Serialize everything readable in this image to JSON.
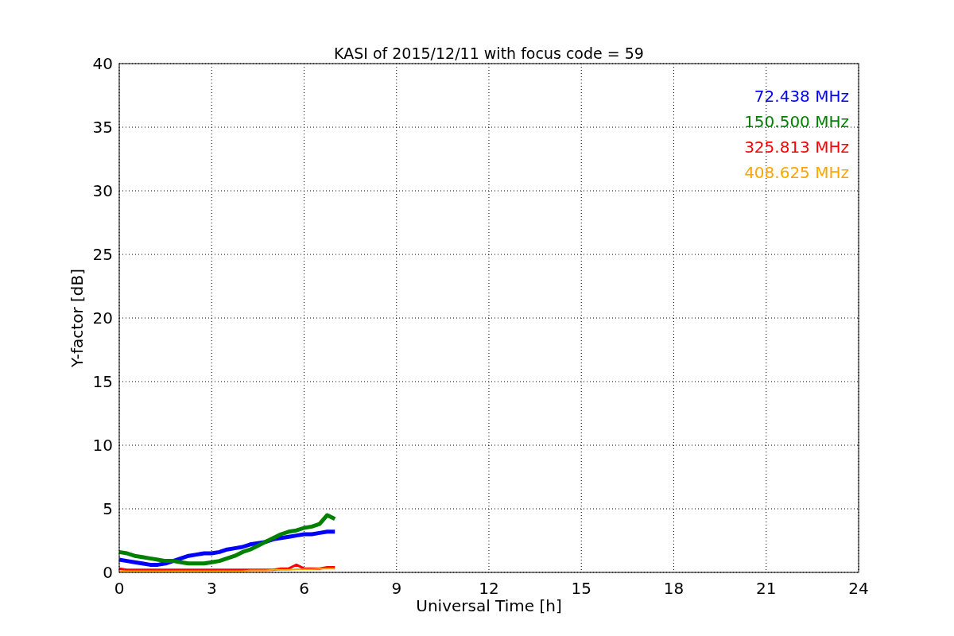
{
  "chart_data": {
    "type": "line",
    "title": "KASI of 2015/12/11 with focus code = 59",
    "xlabel": "Universal Time [h]",
    "ylabel": "Y-factor [dB]",
    "x": [
      0,
      0.25,
      0.5,
      0.75,
      1,
      1.25,
      1.5,
      1.75,
      2,
      2.25,
      2.5,
      2.75,
      3,
      3.25,
      3.5,
      3.75,
      4,
      4.25,
      4.5,
      4.75,
      5,
      5.25,
      5.5,
      5.75,
      6,
      6.25,
      6.5,
      6.75,
      7
    ],
    "grid": true,
    "xlim": [
      0,
      24
    ],
    "ylim": [
      0,
      40
    ],
    "xticks": [
      0,
      3,
      6,
      9,
      12,
      15,
      18,
      21,
      24
    ],
    "yticks": [
      0,
      5,
      10,
      15,
      20,
      25,
      30,
      35,
      40
    ],
    "series": [
      {
        "name": "72.438 MHz",
        "color": "#0000ff",
        "values": [
          1.0,
          0.9,
          0.8,
          0.7,
          0.6,
          0.6,
          0.7,
          0.9,
          1.1,
          1.3,
          1.4,
          1.5,
          1.5,
          1.6,
          1.8,
          1.9,
          2.0,
          2.2,
          2.3,
          2.4,
          2.6,
          2.7,
          2.8,
          2.9,
          3.0,
          3.0,
          3.1,
          3.2,
          3.2
        ]
      },
      {
        "name": "150.500 MHz",
        "color": "#008000",
        "values": [
          1.6,
          1.5,
          1.3,
          1.2,
          1.1,
          1.0,
          0.9,
          0.9,
          0.8,
          0.7,
          0.7,
          0.7,
          0.8,
          0.9,
          1.1,
          1.3,
          1.6,
          1.8,
          2.1,
          2.4,
          2.7,
          3.0,
          3.2,
          3.3,
          3.5,
          3.6,
          3.8,
          4.5,
          4.2
        ]
      },
      {
        "name": "325.813 MHz",
        "color": "#ff0000",
        "values": [
          0.3,
          0.2,
          0.2,
          0.2,
          0.2,
          0.2,
          0.2,
          0.2,
          0.2,
          0.2,
          0.2,
          0.2,
          0.2,
          0.2,
          0.2,
          0.2,
          0.2,
          0.2,
          0.2,
          0.2,
          0.2,
          0.3,
          0.3,
          0.6,
          0.3,
          0.3,
          0.3,
          0.4,
          0.4
        ]
      },
      {
        "name": "408.625 MHz",
        "color": "#ffa500",
        "values": [
          0.1,
          0.1,
          0.1,
          0.1,
          0.1,
          0.1,
          0.1,
          0.1,
          0.1,
          0.1,
          0.1,
          0.1,
          0.1,
          0.1,
          0.1,
          0.1,
          0.1,
          0.15,
          0.15,
          0.15,
          0.2,
          0.2,
          0.2,
          0.25,
          0.25,
          0.25,
          0.3,
          0.3,
          0.3
        ]
      }
    ]
  }
}
